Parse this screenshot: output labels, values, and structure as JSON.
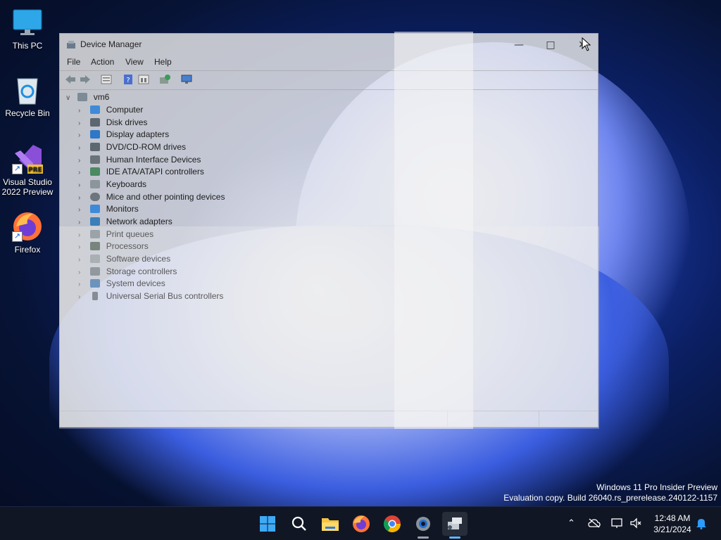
{
  "desktop": {
    "icons": [
      {
        "label": "This PC",
        "icon": "monitor-icon"
      },
      {
        "label": "Recycle Bin",
        "icon": "recycle-bin-icon"
      },
      {
        "label": "Visual Studio 2022 Preview",
        "icon": "visual-studio-icon",
        "badge": "PRE"
      },
      {
        "label": "Firefox",
        "icon": "firefox-icon"
      }
    ]
  },
  "window": {
    "title": "Device Manager",
    "menu": [
      "File",
      "Action",
      "View",
      "Help"
    ],
    "tree": {
      "root": "vm6",
      "items": [
        "Computer",
        "Disk drives",
        "Display adapters",
        "DVD/CD-ROM drives",
        "Human Interface Devices",
        "IDE ATA/ATAPI controllers",
        "Keyboards",
        "Mice and other pointing devices",
        "Monitors",
        "Network adapters",
        "Print queues",
        "Processors",
        "Software devices",
        "Storage controllers",
        "System devices",
        "Universal Serial Bus controllers"
      ]
    }
  },
  "watermark": {
    "line1": "Windows 11 Pro Insider Preview",
    "line2": "Evaluation copy. Build 26040.rs_prerelease.240122-1157"
  },
  "taskbar": {
    "apps": [
      "start-icon",
      "search-icon",
      "file-explorer-icon",
      "firefox-icon",
      "chrome-icon",
      "settings-icon",
      "device-manager-icon"
    ],
    "clock": {
      "time": "12:48 AM",
      "date": "3/21/2024"
    }
  },
  "colors": {
    "accent": "#0078d4",
    "taskbar_bg": "#101624"
  }
}
